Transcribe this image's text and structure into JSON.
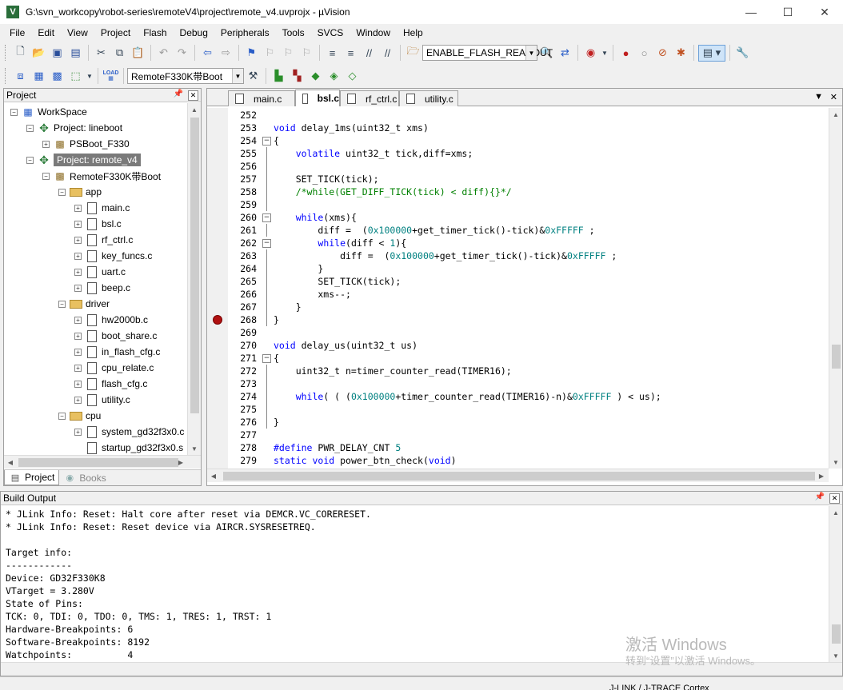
{
  "window": {
    "title": "G:\\svn_workcopy\\robot-series\\remoteV4\\project\\remote_v4.uvprojx - µVision",
    "minimize": "—",
    "maximize": "☐",
    "close": "✕"
  },
  "menu": [
    "File",
    "Edit",
    "View",
    "Project",
    "Flash",
    "Debug",
    "Peripherals",
    "Tools",
    "SVCS",
    "Window",
    "Help"
  ],
  "toolbar": {
    "define_combo": "ENABLE_FLASH_READOUT",
    "target_combo": "RemoteF330K带Boot",
    "load_label": "LOAD"
  },
  "project_panel": {
    "title": "Project",
    "pin": "📌",
    "close": "✕",
    "tabs": [
      "Project",
      "Books"
    ]
  },
  "tree": [
    {
      "label": "WorkSpace",
      "indent": 0,
      "exp": "-",
      "type": "ws"
    },
    {
      "label": "Project: lineboot",
      "indent": 1,
      "exp": "-",
      "type": "proj"
    },
    {
      "label": "PSBoot_F330",
      "indent": 2,
      "exp": "+",
      "type": "target"
    },
    {
      "label": "Project: remote_v4",
      "indent": 1,
      "exp": "-",
      "type": "proj",
      "selected": true
    },
    {
      "label": "RemoteF330K带Boot",
      "indent": 2,
      "exp": "-",
      "type": "target"
    },
    {
      "label": "app",
      "indent": 3,
      "exp": "-",
      "type": "folder"
    },
    {
      "label": "main.c",
      "indent": 4,
      "exp": "+",
      "type": "file"
    },
    {
      "label": "bsl.c",
      "indent": 4,
      "exp": "+",
      "type": "file"
    },
    {
      "label": "rf_ctrl.c",
      "indent": 4,
      "exp": "+",
      "type": "file"
    },
    {
      "label": "key_funcs.c",
      "indent": 4,
      "exp": "+",
      "type": "file"
    },
    {
      "label": "uart.c",
      "indent": 4,
      "exp": "+",
      "type": "file"
    },
    {
      "label": "beep.c",
      "indent": 4,
      "exp": "+",
      "type": "file"
    },
    {
      "label": "driver",
      "indent": 3,
      "exp": "-",
      "type": "folder"
    },
    {
      "label": "hw2000b.c",
      "indent": 4,
      "exp": "+",
      "type": "file"
    },
    {
      "label": "boot_share.c",
      "indent": 4,
      "exp": "+",
      "type": "file"
    },
    {
      "label": "in_flash_cfg.c",
      "indent": 4,
      "exp": "+",
      "type": "file"
    },
    {
      "label": "cpu_relate.c",
      "indent": 4,
      "exp": "+",
      "type": "file"
    },
    {
      "label": "flash_cfg.c",
      "indent": 4,
      "exp": "+",
      "type": "file"
    },
    {
      "label": "utility.c",
      "indent": 4,
      "exp": "+",
      "type": "file"
    },
    {
      "label": "cpu",
      "indent": 3,
      "exp": "-",
      "type": "folder"
    },
    {
      "label": "system_gd32f3x0.c",
      "indent": 4,
      "exp": "+",
      "type": "file"
    },
    {
      "label": "startup_gd32f3x0.s",
      "indent": 4,
      "exp": "",
      "type": "file"
    }
  ],
  "editor": {
    "tabs": [
      {
        "label": "main.c",
        "active": false
      },
      {
        "label": "bsl.c",
        "active": true
      },
      {
        "label": "rf_ctrl.c",
        "active": false
      },
      {
        "label": "utility.c",
        "active": false
      }
    ],
    "tab_menu": "▼",
    "tab_close": "✕",
    "lines": [
      {
        "n": "252",
        "fold": "",
        "html": ""
      },
      {
        "n": "253",
        "fold": "",
        "html": "<span class='kw'>void</span> delay_1ms(uint32_t xms)"
      },
      {
        "n": "254",
        "fold": "-",
        "html": "{"
      },
      {
        "n": "255",
        "fold": "|",
        "html": "    <span class='kw'>volatile</span> uint32_t tick,diff=xms;"
      },
      {
        "n": "256",
        "fold": "|",
        "html": ""
      },
      {
        "n": "257",
        "fold": "|",
        "html": "    SET_TICK(tick);"
      },
      {
        "n": "258",
        "fold": "|",
        "html": "    <span class='cm'>/*while(GET_DIFF_TICK(tick) &lt; diff){}*/</span>"
      },
      {
        "n": "259",
        "fold": "|",
        "html": ""
      },
      {
        "n": "260",
        "fold": "-",
        "html": "    <span class='kw'>while</span>(xms){"
      },
      {
        "n": "261",
        "fold": "|",
        "html": "        diff =  (<span class='nm'>0x100000</span>+get_timer_tick()-tick)&amp;<span class='nm'>0xFFFFF</span> ;"
      },
      {
        "n": "262",
        "fold": "-",
        "html": "        <span class='kw'>while</span>(diff &lt; <span class='nm'>1</span>){"
      },
      {
        "n": "263",
        "fold": "|",
        "html": "            diff =  (<span class='nm'>0x100000</span>+get_timer_tick()-tick)&amp;<span class='nm'>0xFFFFF</span> ;"
      },
      {
        "n": "264",
        "fold": "|",
        "html": "        }"
      },
      {
        "n": "265",
        "fold": "|",
        "html": "        SET_TICK(tick);"
      },
      {
        "n": "266",
        "fold": "|",
        "html": "        xms--;"
      },
      {
        "n": "267",
        "fold": "|",
        "html": "    }"
      },
      {
        "n": "268",
        "fold": "|",
        "html": "}",
        "breakpoint": true
      },
      {
        "n": "269",
        "fold": "",
        "html": ""
      },
      {
        "n": "270",
        "fold": "",
        "html": "<span class='kw'>void</span> delay_us(uint32_t us)"
      },
      {
        "n": "271",
        "fold": "-",
        "html": "{"
      },
      {
        "n": "272",
        "fold": "|",
        "html": "    uint32_t n=timer_counter_read(TIMER16);"
      },
      {
        "n": "273",
        "fold": "|",
        "html": ""
      },
      {
        "n": "274",
        "fold": "|",
        "html": "    <span class='kw'>while</span>( ( (<span class='nm'>0x100000</span>+timer_counter_read(TIMER16)-n)&amp;<span class='nm'>0xFFFFF</span> ) &lt; us);"
      },
      {
        "n": "275",
        "fold": "|",
        "html": ""
      },
      {
        "n": "276",
        "fold": "|",
        "html": "}"
      },
      {
        "n": "277",
        "fold": "",
        "html": ""
      },
      {
        "n": "278",
        "fold": "",
        "html": "<span class='pp'>#define</span> PWR_DELAY_CNT <span class='nm'>5</span>"
      },
      {
        "n": "279",
        "fold": "",
        "html": "<span class='kw'>static</span> <span class='kw'>void</span> power_btn_check(<span class='kw'>void</span>)"
      }
    ]
  },
  "build_output": {
    "title": "Build Output",
    "lines": [
      "* JLink Info: Reset: Halt core after reset via DEMCR.VC_CORERESET.",
      "* JLink Info: Reset: Reset device via AIRCR.SYSRESETREQ.",
      "",
      "Target info:",
      "------------",
      "Device: GD32F330K8",
      "VTarget = 3.280V",
      "State of Pins:",
      "TCK: 0, TDI: 0, TDO: 0, TMS: 1, TRES: 1, TRST: 1",
      "Hardware-Breakpoints: 6",
      "Software-Breakpoints: 8192",
      "Watchpoints:          4"
    ]
  },
  "watermark": {
    "line1": "激活 Windows",
    "line2": "转到“设置”以激活 Windows。"
  },
  "status": {
    "debugger": "J-LINK / J-TRACE Cortex"
  }
}
